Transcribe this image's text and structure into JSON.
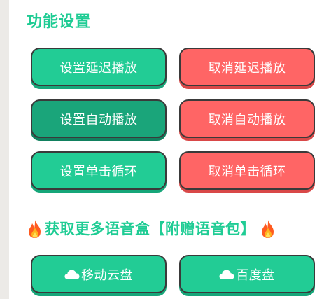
{
  "settings": {
    "title": "功能设置",
    "buttons": [
      {
        "label": "设置延迟播放",
        "color": "#22cc95"
      },
      {
        "label": "取消延迟播放",
        "color": "#ff6565"
      },
      {
        "label": "设置自动播放",
        "color": "#1aa57a"
      },
      {
        "label": "取消自动播放",
        "color": "#ff6565"
      },
      {
        "label": "设置单击循环",
        "color": "#22cc95"
      },
      {
        "label": "取消单击循环",
        "color": "#ff6565"
      }
    ]
  },
  "promo": {
    "title": "获取更多语音盒【附赠语音包】",
    "left_icon": "fire-icon",
    "right_icon": "fire-icon",
    "links": [
      {
        "label": "移动云盘",
        "icon": "cloud-icon"
      },
      {
        "label": "百度盘",
        "icon": "cloud-icon"
      }
    ]
  },
  "colors": {
    "accent": "#1fcc94",
    "green": "#22cc95",
    "green_active": "#1aa57a",
    "red": "#ff6565"
  }
}
